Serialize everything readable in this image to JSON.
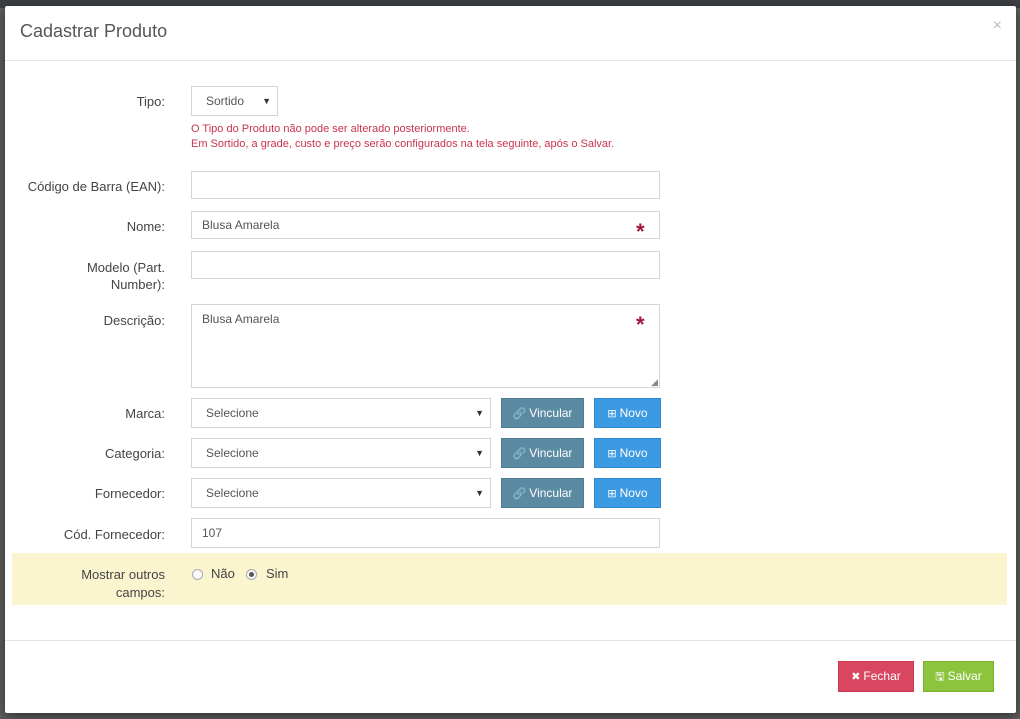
{
  "modal": {
    "title": "Cadastrar Produto",
    "close_symbol": "×"
  },
  "form": {
    "tipo": {
      "label": "Tipo:",
      "value": "Sortido",
      "hint_line1": "O Tipo do Produto não pode ser alterado posteriormente.",
      "hint_line2": "Em Sortido, a grade, custo e preço serão configurados na tela seguinte, após o Salvar."
    },
    "ean": {
      "label": "Código de Barra (EAN):",
      "value": ""
    },
    "nome": {
      "label": "Nome:",
      "value": "Blusa Amarela",
      "required_mark": "*"
    },
    "modelo": {
      "label_line1": "Modelo (Part.",
      "label_line2": "Number):",
      "value": ""
    },
    "descricao": {
      "label": "Descrição:",
      "value": "Blusa Amarela",
      "required_mark": "*"
    },
    "marca": {
      "label": "Marca:",
      "value": "Selecione"
    },
    "categoria": {
      "label": "Categoria:",
      "value": "Selecione"
    },
    "fornecedor": {
      "label": "Fornecedor:",
      "value": "Selecione"
    },
    "cod_fornecedor": {
      "label": "Cód. Fornecedor:",
      "value": "107"
    },
    "mostrar": {
      "label_line1": "Mostrar outros",
      "label_line2": "campos:",
      "option_nao": "Não",
      "option_sim": "Sim",
      "selected": "Sim"
    }
  },
  "buttons": {
    "vincular": "Vincular",
    "novo": "Novo",
    "fechar": "Fechar",
    "salvar": "Salvar"
  },
  "icons": {
    "link": "link-icon",
    "plus": "plus-square-icon",
    "times": "times-icon",
    "save": "save-icon"
  },
  "colors": {
    "hint": "#c9344b",
    "required": "#a0183a",
    "vincular": "#5b8aa3",
    "novo": "#3b9ae1",
    "fechar": "#d9465f",
    "salvar": "#8cc43e",
    "highlight": "#faf4cf"
  }
}
